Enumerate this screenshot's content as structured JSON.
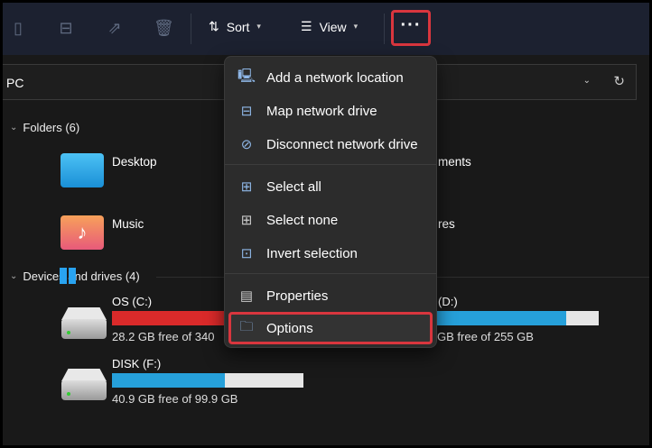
{
  "toolbar": {
    "sort_label": "Sort",
    "view_label": "View",
    "more_label": "···"
  },
  "address": {
    "location": "PC"
  },
  "folders": {
    "header": "Folders (6)",
    "items": [
      {
        "label": "Desktop"
      },
      {
        "label": "ments"
      },
      {
        "label": "Music"
      },
      {
        "label": "res"
      }
    ]
  },
  "drives": {
    "header": "Devices and drives (4)",
    "items": [
      {
        "label": "OS (C:)",
        "free_text": "28.2 GB free of 340",
        "used_fraction": 0.917,
        "color": "#da2a2a"
      },
      {
        "label": "(D:)",
        "free_text": "GB free of 255 GB",
        "used_fraction": 0.85,
        "color": "#26a0da"
      },
      {
        "label": "DISK (F:)",
        "free_text": "40.9 GB free of 99.9 GB",
        "used_fraction": 0.59,
        "color": "#26a0da"
      }
    ]
  },
  "menu": {
    "items": [
      {
        "label": "Add a network location",
        "icon": "network-location-icon"
      },
      {
        "label": "Map network drive",
        "icon": "map-drive-icon"
      },
      {
        "label": "Disconnect network drive",
        "icon": "disconnect-drive-icon"
      },
      {
        "label": "Select all",
        "icon": "select-all-icon"
      },
      {
        "label": "Select none",
        "icon": "select-none-icon"
      },
      {
        "label": "Invert selection",
        "icon": "invert-selection-icon"
      },
      {
        "label": "Properties",
        "icon": "properties-icon"
      },
      {
        "label": "Options",
        "icon": "options-icon"
      }
    ]
  }
}
